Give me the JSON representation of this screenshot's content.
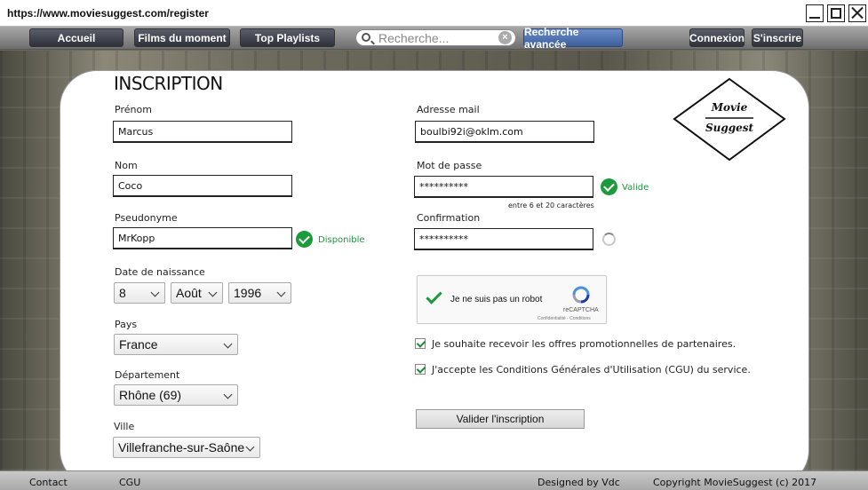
{
  "window": {
    "url": "https://www.moviesuggest.com/register"
  },
  "nav": {
    "accueil": "Accueil",
    "films": "Films du moment",
    "playlists": "Top Playlists",
    "search_placeholder": "Recherche...",
    "search_clear": "×",
    "advanced": "Recherche avancée",
    "connexion": "Connexion",
    "inscrire": "S'inscrire"
  },
  "form": {
    "title": "INSCRIPTION",
    "prenom_label": "Prénom",
    "prenom_value": "Marcus",
    "nom_label": "Nom",
    "nom_value": "Coco",
    "pseudo_label": "Pseudonyme",
    "pseudo_value": "MrKopp",
    "pseudo_status": "Disponible",
    "dob_label": "Date de naissance",
    "dob_day": "8",
    "dob_month": "Août",
    "dob_year": "1996",
    "pays_label": "Pays",
    "pays_value": "France",
    "dept_label": "Département",
    "dept_value": "Rhône (69)",
    "ville_label": "Ville",
    "ville_value": "Villefranche-sur-Saône",
    "email_label": "Adresse mail",
    "email_value": "boulbi92i@oklm.com",
    "password_label": "Mot de passe",
    "password_value": "**********",
    "password_status": "Valide",
    "password_hint": "entre 6 et 20 caractères",
    "confirm_label": "Confirmation",
    "confirm_value": "**********",
    "captcha_text": "Je ne suis pas un robot",
    "captcha_brand": "reCAPTCHA",
    "captcha_links": "Confidentialité - Conditions",
    "opt_offers": "Je souhaite recevoir les offres promotionnelles de partenaires.",
    "opt_cgu": "J'accepte les Conditions Générales d'Utilisation (CGU) du service.",
    "submit": "Valider l'inscription"
  },
  "logo": {
    "line1": "Movie",
    "line2": "Suggest"
  },
  "footer": {
    "contact": "Contact",
    "cgu": "CGU",
    "designed": "Designed by Vdc",
    "copyright": "Copyright MovieSuggest (c) 2017"
  },
  "colors": {
    "accent": "#3d5f9d",
    "success": "#1c9b3a",
    "nav_dark": "#2e313a"
  }
}
